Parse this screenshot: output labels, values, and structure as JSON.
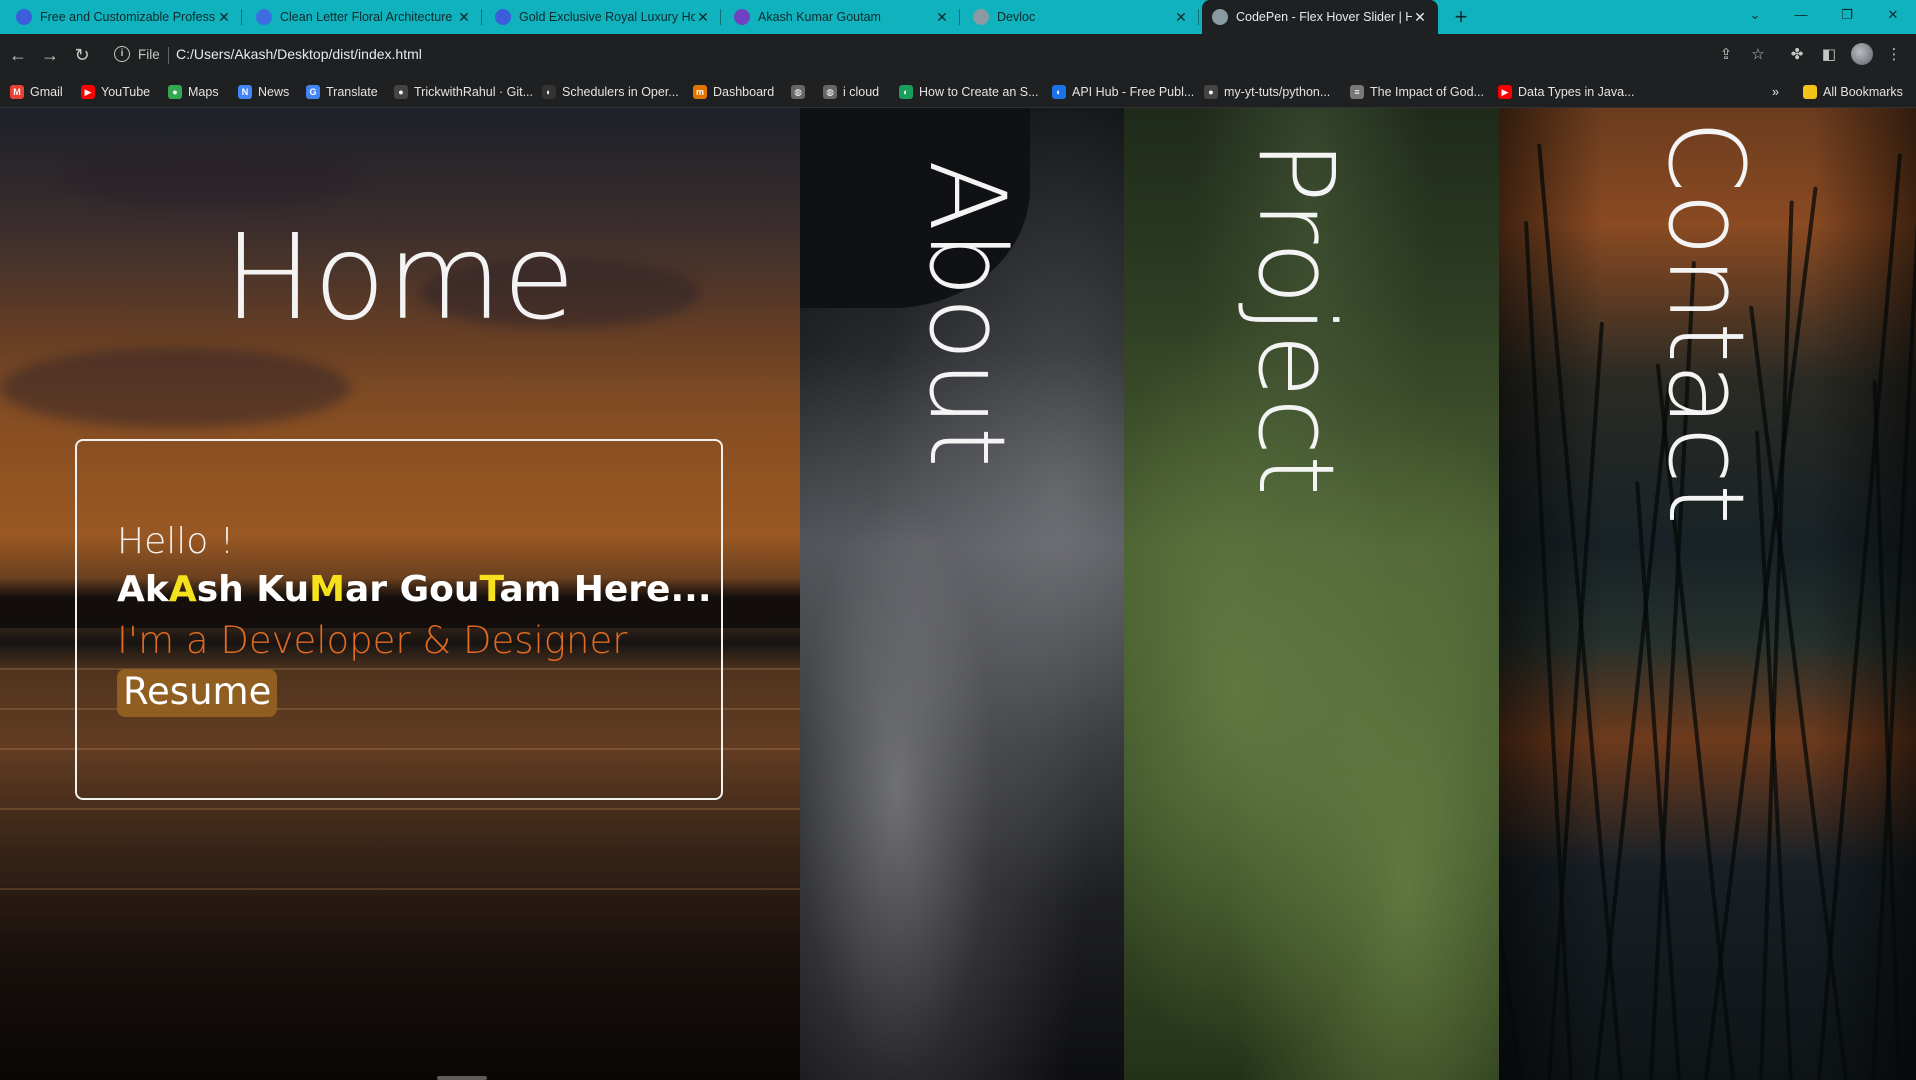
{
  "browser": {
    "tabs": [
      {
        "label": "Free and Customizable Professio",
        "icon": "canva-icon",
        "icon_color": "#3c5ddb",
        "active": false
      },
      {
        "label": "Clean Letter Floral Architecture",
        "icon": "document-icon",
        "icon_color": "#3d6de0",
        "active": false
      },
      {
        "label": "Gold Exclusive Royal Luxury Hot",
        "icon": "canva-icon",
        "icon_color": "#3c5ddb",
        "active": false
      },
      {
        "label": "Akash Kumar Goutam",
        "icon": "bootstrap-icon",
        "icon_color": "#6f42c1",
        "active": false
      },
      {
        "label": "Devloc",
        "icon": "globe-icon",
        "icon_color": "#8a9aa3",
        "active": false
      },
      {
        "label": "CodePen - Flex Hover Slider | HT",
        "icon": "globe-icon",
        "icon_color": "#8a9aa3",
        "active": true
      }
    ],
    "address": {
      "scheme_label": "File",
      "url": "C:/Users/Akash/Desktop/dist/index.html"
    },
    "bookmarks": [
      {
        "label": "Gmail",
        "icon": "gmail-icon",
        "color": "#ea4335"
      },
      {
        "label": "YouTube",
        "icon": "youtube-icon",
        "color": "#ff0000"
      },
      {
        "label": "Maps",
        "icon": "maps-icon",
        "color": "#34a853"
      },
      {
        "label": "News",
        "icon": "news-icon",
        "color": "#4285f4"
      },
      {
        "label": "Translate",
        "icon": "translate-icon",
        "color": "#4285f4"
      },
      {
        "label": "TrickwithRahul · Git...",
        "icon": "github-icon",
        "color": "#444"
      },
      {
        "label": "Schedulers in Oper...",
        "icon": "bookmark-icon",
        "color": "#333"
      },
      {
        "label": "Dashboard",
        "icon": "dashboard-icon",
        "color": "#e37400"
      },
      {
        "label": "",
        "icon": "globe-icon",
        "color": "#666"
      },
      {
        "label": "i cloud",
        "icon": "globe-icon",
        "color": "#666"
      },
      {
        "label": "How to Create an S...",
        "icon": "bookmark-icon",
        "color": "#1a9e5a"
      },
      {
        "label": "API Hub - Free Publ...",
        "icon": "bookmark-icon",
        "color": "#1a73e8"
      },
      {
        "label": "my-yt-tuts/python...",
        "icon": "github-icon",
        "color": "#444"
      },
      {
        "label": "The Impact of God...",
        "icon": "document-icon",
        "color": "#777"
      },
      {
        "label": "Data Types in Java...",
        "icon": "youtube-icon",
        "color": "#ff0000"
      }
    ],
    "all_bookmarks_label": "All Bookmarks",
    "more_label": "»"
  },
  "page": {
    "home": {
      "title": "Home",
      "hello": "Hello !",
      "name_parts": [
        {
          "text": "Ak",
          "highlight": false
        },
        {
          "text": "A",
          "highlight": true
        },
        {
          "text": "sh Ku",
          "highlight": false
        },
        {
          "text": "M",
          "highlight": true
        },
        {
          "text": "ar Gou",
          "highlight": false
        },
        {
          "text": "T",
          "highlight": true
        },
        {
          "text": "am Here...",
          "highlight": false
        }
      ],
      "role": "I'm a Developer & Designer",
      "resume_label": "Resume"
    },
    "about": {
      "title": "About"
    },
    "project": {
      "title": "Project"
    },
    "contact": {
      "title": "Contact"
    }
  },
  "colors": {
    "tab_strip": "#10b3bd",
    "highlight_letter": "#f5e21c",
    "role_text": "#e06a22",
    "resume_bg": "#8f5e20"
  }
}
